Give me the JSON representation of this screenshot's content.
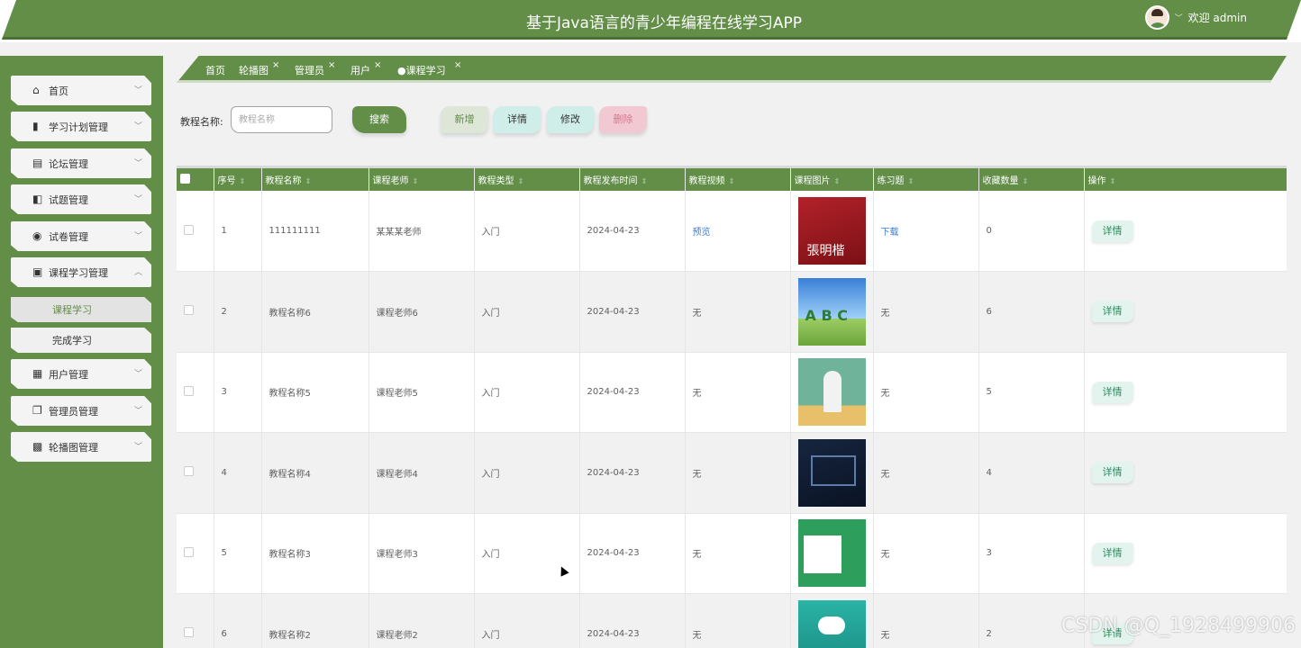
{
  "header": {
    "title": "基于Java语言的青少年编程在线学习APP",
    "welcome": "欢迎 admin",
    "avatar_icon": "user-avatar"
  },
  "sidebar": {
    "items": [
      {
        "label": "首页",
        "icon": "home-icon"
      },
      {
        "label": "学习计划管理",
        "icon": "chart-icon"
      },
      {
        "label": "论坛管理",
        "icon": "server-icon"
      },
      {
        "label": "试题管理",
        "icon": "crop-icon"
      },
      {
        "label": "试卷管理",
        "icon": "compass-icon"
      },
      {
        "label": "课程学习管理",
        "icon": "briefcase-icon",
        "expanded": true
      },
      {
        "label": "用户管理",
        "icon": "book-icon"
      },
      {
        "label": "管理员管理",
        "icon": "copy-icon"
      },
      {
        "label": "轮播图管理",
        "icon": "grid-icon"
      }
    ],
    "sub_items": [
      {
        "label": "课程学习",
        "active": true
      },
      {
        "label": "完成学习",
        "active": false
      }
    ]
  },
  "tabs": [
    {
      "label": "首页",
      "closable": false
    },
    {
      "label": "轮播图",
      "closable": true
    },
    {
      "label": "管理员",
      "closable": true
    },
    {
      "label": "用户",
      "closable": true
    },
    {
      "label": "●课程学习",
      "closable": true,
      "active": true
    }
  ],
  "search": {
    "label": "教程名称:",
    "placeholder": "教程名称",
    "search_button": "搜索"
  },
  "actions": {
    "add": "新增",
    "detail": "详情",
    "edit": "修改",
    "delete": "删除"
  },
  "table": {
    "columns": [
      "序号",
      "教程名称",
      "课程老师",
      "教程类型",
      "教程发布时间",
      "教程视频",
      "课程图片",
      "练习题",
      "收藏数量",
      "操作"
    ],
    "rows": [
      {
        "no": "1",
        "name": "111111111",
        "teacher": "某某某老师",
        "type": "入门",
        "date": "2024-04-23",
        "video": "预览",
        "video_link": true,
        "image": "t1",
        "exercise": "下载",
        "exercise_link": true,
        "favorites": "0",
        "op": "详情"
      },
      {
        "no": "2",
        "name": "教程名称6",
        "teacher": "课程老师6",
        "type": "入门",
        "date": "2024-04-23",
        "video": "无",
        "video_link": false,
        "image": "t2",
        "exercise": "无",
        "exercise_link": false,
        "favorites": "6",
        "op": "详情"
      },
      {
        "no": "3",
        "name": "教程名称5",
        "teacher": "课程老师5",
        "type": "入门",
        "date": "2024-04-23",
        "video": "无",
        "video_link": false,
        "image": "t3",
        "exercise": "无",
        "exercise_link": false,
        "favorites": "5",
        "op": "详情"
      },
      {
        "no": "4",
        "name": "教程名称4",
        "teacher": "课程老师4",
        "type": "入门",
        "date": "2024-04-23",
        "video": "无",
        "video_link": false,
        "image": "t4",
        "exercise": "无",
        "exercise_link": false,
        "favorites": "4",
        "op": "详情"
      },
      {
        "no": "5",
        "name": "教程名称3",
        "teacher": "课程老师3",
        "type": "入门",
        "date": "2024-04-23",
        "video": "无",
        "video_link": false,
        "image": "t5",
        "exercise": "无",
        "exercise_link": false,
        "favorites": "3",
        "op": "详情"
      },
      {
        "no": "6",
        "name": "教程名称2",
        "teacher": "课程老师2",
        "type": "入门",
        "date": "2024-04-23",
        "video": "无",
        "video_link": false,
        "image": "t6",
        "exercise": "无",
        "exercise_link": false,
        "favorites": "2",
        "op": "详情"
      }
    ]
  },
  "watermark": "CSDN @Q_1928499906",
  "colors": {
    "primary": "#628e48",
    "link": "#3b7bd6",
    "delete": "#f2c9d2",
    "detail": "#cfeee9"
  }
}
